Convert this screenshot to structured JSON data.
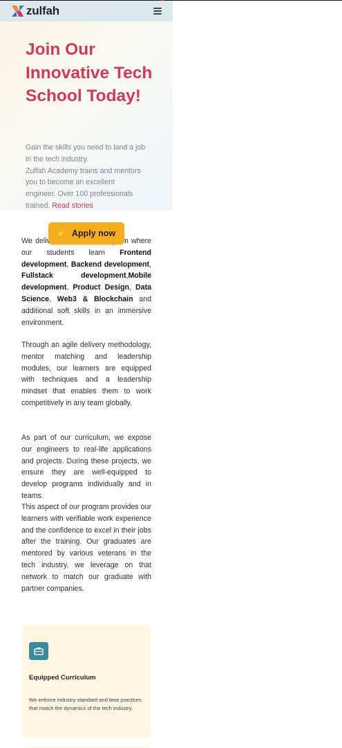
{
  "brand": {
    "name": "zulfah",
    "accent": "#d1385f",
    "button_color": "#f4ad1f",
    "icon_color": "#3d8b9a"
  },
  "nav": {
    "menu_icon": "hamburger-menu-icon"
  },
  "hero": {
    "title": "Join Our Innovative Tech School Today!",
    "desc_line1": "Gain the skills you need to land a job in the tech industry.",
    "desc_line2": "Zulfah Academy trains and mentors you to become an excellent engineer. Over 100 professionals trained.",
    "read_link": "Read stories"
  },
  "cta": {
    "label": "Apply now",
    "icon": "pointing-hand-icon",
    "icon_glyph": "👉"
  },
  "content": {
    "p1_intro": "We deliver a 6 months program where our students learn",
    "p1_frontend": "Frontend development",
    "p1_backend": "Backend development",
    "p1_fullstack": "Fullstack development",
    "p1_mobile": "Mobile development",
    "p1_product": "Product Design",
    "p1_data": "Data Science",
    "p1_web3": "Web3 & Blockchain",
    "p1_outro": "and additional soft skills in an immersive environment.",
    "p2": "Through an agile delivery methodology, mentor matching and leadership modules, our learners are equipped with techniques and a leadership mindset that enables them to work competitively in any team globally.",
    "p3": "As part of our curriculum, we expose our engineers to real-life applications and projects. During these projects, we ensure they are well-equipped to develop programs individually and in teams.",
    "p4": "This aspect of our program provides our learners with verifiable work experience and the confidence to excel in their jobs after the training. Our graduates are mentored by various veterans in the tech industry, we leverage on that network to match our graduate with partner companies."
  },
  "cards": [
    {
      "icon": "briefcase-icon",
      "title": "Equipped Curriculum",
      "desc": "We enforce industry standard and best practices that match the dynamics of the tech industry."
    }
  ]
}
